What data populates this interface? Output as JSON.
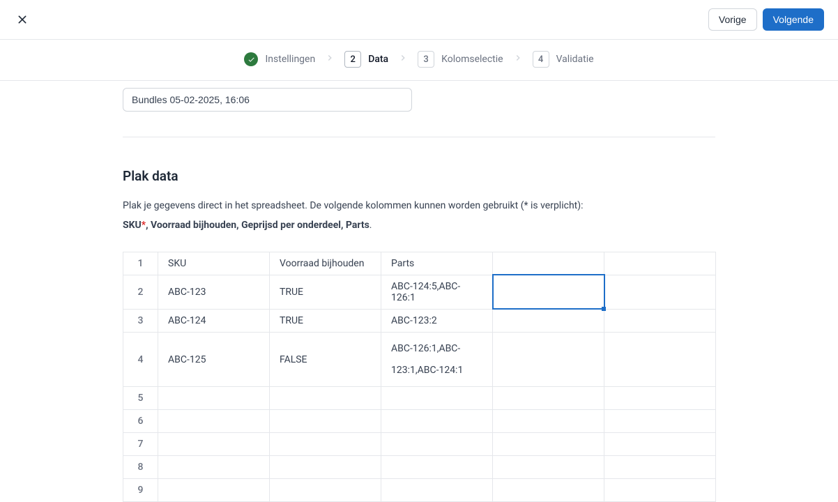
{
  "header": {
    "prev_label": "Vorige",
    "next_label": "Volgende"
  },
  "stepper": {
    "step1": {
      "label": "Instellingen"
    },
    "step2": {
      "num": "2",
      "label": "Data"
    },
    "step3": {
      "num": "3",
      "label": "Kolomselectie"
    },
    "step4": {
      "num": "4",
      "label": "Validatie"
    }
  },
  "name_field": {
    "value": "Bundles 05-02-2025, 16:06"
  },
  "section": {
    "title": "Plak data",
    "description": "Plak je gegevens direct in het spreadsheet. De volgende kolommen kunnen worden gebruikt (* is verplicht):",
    "columns_required": "SKU",
    "columns_rest": ", Voorraad bijhouden, Geprijsd per onderdeel, Parts",
    "period": "."
  },
  "spreadsheet": {
    "headers": [
      "SKU",
      "Voorraad bijhouden",
      "Parts",
      "",
      ""
    ],
    "rows": [
      {
        "num": "1",
        "cells": [
          "SKU",
          "Voorraad bijhouden",
          "Parts",
          "",
          ""
        ]
      },
      {
        "num": "2",
        "cells": [
          "ABC-123",
          "TRUE",
          "ABC-124:5,ABC-126:1",
          "",
          ""
        ]
      },
      {
        "num": "3",
        "cells": [
          "ABC-124",
          "TRUE",
          "ABC-123:2",
          "",
          ""
        ]
      },
      {
        "num": "4",
        "cells": [
          "ABC-125",
          "FALSE",
          "ABC-126:1,ABC-123:1,ABC-124:1",
          "",
          ""
        ]
      },
      {
        "num": "5",
        "cells": [
          "",
          "",
          "",
          "",
          ""
        ]
      },
      {
        "num": "6",
        "cells": [
          "",
          "",
          "",
          "",
          ""
        ]
      },
      {
        "num": "7",
        "cells": [
          "",
          "",
          "",
          "",
          ""
        ]
      },
      {
        "num": "8",
        "cells": [
          "",
          "",
          "",
          "",
          ""
        ]
      },
      {
        "num": "9",
        "cells": [
          "",
          "",
          "",
          "",
          ""
        ]
      }
    ],
    "selected": {
      "row": 1,
      "col": 3
    }
  }
}
